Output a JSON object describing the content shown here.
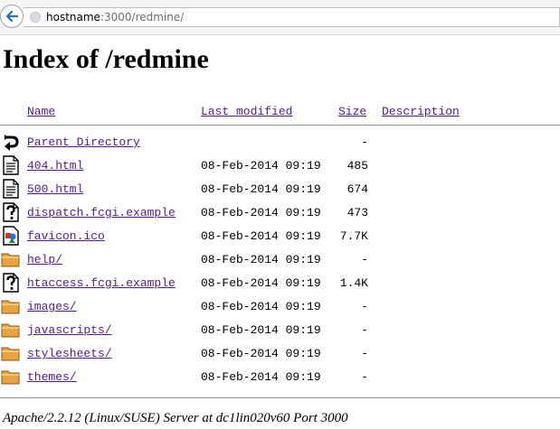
{
  "browser": {
    "url_host": "hostname",
    "url_rest": ":3000/redmine/"
  },
  "page": {
    "title": "Index of /redmine",
    "columns": {
      "name": "Name",
      "last_modified": "Last modified",
      "size": "Size",
      "description": "Description"
    },
    "rows": [
      {
        "icon": "back-icon",
        "name": "Parent Directory",
        "date": "",
        "size": "-"
      },
      {
        "icon": "text-icon",
        "name": "404.html",
        "date": "08-Feb-2014 09:19",
        "size": "485"
      },
      {
        "icon": "text-icon",
        "name": "500.html",
        "date": "08-Feb-2014 09:19",
        "size": "674"
      },
      {
        "icon": "unknown-icon",
        "name": "dispatch.fcgi.example",
        "date": "08-Feb-2014 09:19",
        "size": "473"
      },
      {
        "icon": "image-icon",
        "name": "favicon.ico",
        "date": "08-Feb-2014 09:19",
        "size": "7.7K"
      },
      {
        "icon": "folder-icon",
        "name": "help/",
        "date": "08-Feb-2014 09:19",
        "size": "-"
      },
      {
        "icon": "unknown-icon",
        "name": "htaccess.fcgi.example",
        "date": "08-Feb-2014 09:19",
        "size": "1.4K"
      },
      {
        "icon": "folder-icon",
        "name": "images/",
        "date": "08-Feb-2014 09:19",
        "size": "-"
      },
      {
        "icon": "folder-icon",
        "name": "javascripts/",
        "date": "08-Feb-2014 09:19",
        "size": "-"
      },
      {
        "icon": "folder-icon",
        "name": "stylesheets/",
        "date": "08-Feb-2014 09:19",
        "size": "-"
      },
      {
        "icon": "folder-icon",
        "name": "themes/",
        "date": "08-Feb-2014 09:19",
        "size": "-"
      }
    ],
    "footer": "Apache/2.2.12 (Linux/SUSE) Server at dc1lin020v60 Port 3000"
  }
}
